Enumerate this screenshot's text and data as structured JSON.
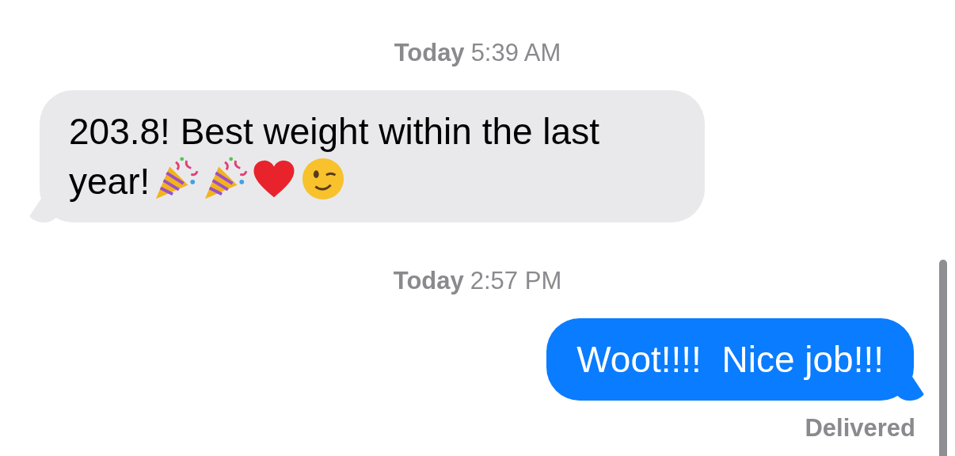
{
  "messages": [
    {
      "kind": "timestamp",
      "day": "Today",
      "time": "5:39 AM"
    },
    {
      "kind": "received",
      "text": "203.8! Best weight within the last year!",
      "emoji": [
        {
          "kind": "party-popper"
        },
        {
          "kind": "party-popper"
        },
        {
          "kind": "heart"
        },
        {
          "kind": "wink"
        }
      ]
    },
    {
      "kind": "timestamp",
      "day": "Today",
      "time": "2:57 PM"
    },
    {
      "kind": "sent",
      "text": "Woot!!!!  Nice job!!!",
      "status": "Delivered"
    }
  ]
}
